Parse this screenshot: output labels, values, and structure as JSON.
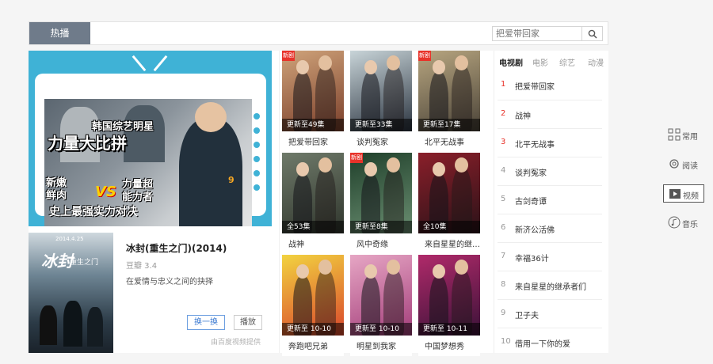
{
  "topbar": {
    "tab_label": "热播",
    "search_placeholder": "把爱带回家"
  },
  "banner": {
    "line1": "韩国综艺明星",
    "line2": "力量大比拼",
    "left_label": "新嫩\n鲜肉",
    "vs": "VS",
    "right_label": "力量超\n能力者",
    "line5": "史上最强实力对决",
    "shirt_number": "9"
  },
  "feature": {
    "poster_date": "2014.4.25",
    "poster_title": "冰封",
    "poster_subtitle": "重生之门",
    "title": "冰封(重生之门)(2014)",
    "rating": "豆瓣 3.4",
    "desc": "在爱情与忠义之间的抉择",
    "swap_label": "换一换",
    "play_label": "播放",
    "source": "由百度视频提供"
  },
  "grid": [
    {
      "title": "把爱带回家",
      "ep": "更新至49集",
      "badge": "新剧",
      "colors": [
        "#cfa37a",
        "#7a3e2a"
      ]
    },
    {
      "title": "谈判冤家",
      "ep": "更新至33集",
      "badge": "",
      "colors": [
        "#c8d4d8",
        "#2b3440"
      ]
    },
    {
      "title": "北平无战事",
      "ep": "更新至17集",
      "badge": "新剧",
      "colors": [
        "#b8a680",
        "#4a4338"
      ]
    },
    {
      "title": "战神",
      "ep": "全53集",
      "badge": "",
      "colors": [
        "#6f7a6a",
        "#2f352c"
      ]
    },
    {
      "title": "风中奇缘",
      "ep": "更新至8集",
      "badge": "新剧",
      "colors": [
        "#1f3f2a",
        "#6b8f72"
      ]
    },
    {
      "title": "来自星星的继承者们",
      "ep": "全10集",
      "badge": "",
      "colors": [
        "#8a1f2a",
        "#2a1218"
      ]
    },
    {
      "title": "奔跑吧兄弟",
      "ep": "更新至 10-10",
      "badge": "",
      "colors": [
        "#f2d340",
        "#d9452b"
      ]
    },
    {
      "title": "明星到我家",
      "ep": "更新至 10-10",
      "badge": "",
      "colors": [
        "#e6a6c4",
        "#a33d7a"
      ]
    },
    {
      "title": "中国梦想秀",
      "ep": "更新至 10-11",
      "badge": "",
      "colors": [
        "#b02a6a",
        "#3a1238"
      ]
    }
  ],
  "rank": {
    "tabs": [
      "电视剧",
      "电影",
      "综艺",
      "动漫"
    ],
    "items": [
      "把爱带回家",
      "战神",
      "北平无战事",
      "谈判冤家",
      "古剑奇谭",
      "新济公活佛",
      "幸福36计",
      "来自星星的继承者们",
      "卫子夫",
      "借用一下你的爱"
    ]
  },
  "sidenav": [
    {
      "label": "常用",
      "icon": "grid-icon"
    },
    {
      "label": "阅读",
      "icon": "gear-icon"
    },
    {
      "label": "视频",
      "icon": "play-icon",
      "active": true
    },
    {
      "label": "音乐",
      "icon": "music-icon"
    }
  ],
  "colors": {
    "accent_red": "#e8332a",
    "banner_blue": "#3fb2d6",
    "tab_gray": "#6f7b8a",
    "link_blue": "#3f7cd2"
  }
}
